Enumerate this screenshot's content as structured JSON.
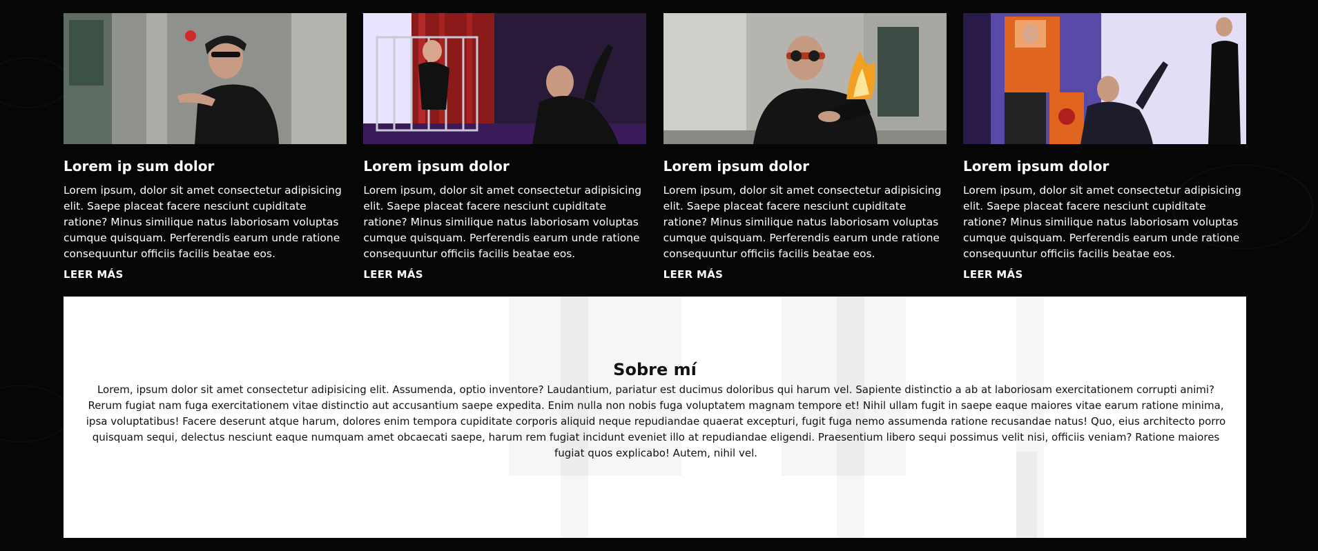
{
  "cards": [
    {
      "title": "Lorem ip sum dolor",
      "text": "Lorem ipsum, dolor sit amet consectetur adipisicing elit. Saepe placeat facere nesciunt cupiditate ratione? Minus similique natus laboriosam voluptas cumque quisquam. Perferendis earum unde ratione consequuntur officiis facilis beatae eos.",
      "link": "LEER MÁS"
    },
    {
      "title": "Lorem ipsum dolor",
      "text": "Lorem ipsum, dolor sit amet consectetur adipisicing elit. Saepe placeat facere nesciunt cupiditate ratione? Minus similique natus laboriosam voluptas cumque quisquam. Perferendis earum unde ratione consequuntur officiis facilis beatae eos.",
      "link": "LEER MÁS"
    },
    {
      "title": "Lorem ipsum dolor",
      "text": "Lorem ipsum, dolor sit amet consectetur adipisicing elit. Saepe placeat facere nesciunt cupiditate ratione? Minus similique natus laboriosam voluptas cumque quisquam. Perferendis earum unde ratione consequuntur officiis facilis beatae eos.",
      "link": "LEER MÁS"
    },
    {
      "title": "Lorem ipsum dolor",
      "text": "Lorem ipsum, dolor sit amet consectetur adipisicing elit. Saepe placeat facere nesciunt cupiditate ratione? Minus similique natus laboriosam voluptas cumque quisquam. Perferendis earum unde ratione consequuntur officiis facilis beatae eos.",
      "link": "LEER MÁS"
    }
  ],
  "about": {
    "title": "Sobre mí",
    "text": "Lorem, ipsum dolor sit amet consectetur adipisicing elit. Assumenda, optio inventore? Laudantium, pariatur est ducimus doloribus qui harum vel. Sapiente distinctio a ab at laboriosam exercitationem corrupti animi? Rerum fugiat nam fuga exercitationem vitae distinctio aut accusantium saepe expedita. Enim nulla non nobis fuga voluptatem magnam tempore et! Nihil ullam fugit in saepe eaque maiores vitae earum ratione minima, ipsa voluptatibus! Facere deserunt atque harum, dolores enim tempora cupiditate corporis aliquid neque repudiandae quaerat excepturi, fugit fuga nemo assumenda ratione recusandae natus! Quo, eius architecto porro quisquam sequi, delectus nesciunt eaque numquam amet obcaecati saepe, harum rem fugiat incidunt eveniet illo at repudiandae eligendi. Praesentium libero sequi possimus velit nisi, officiis veniam? Ratione maiores fugiat quos explicabo! Autem, nihil vel."
  }
}
